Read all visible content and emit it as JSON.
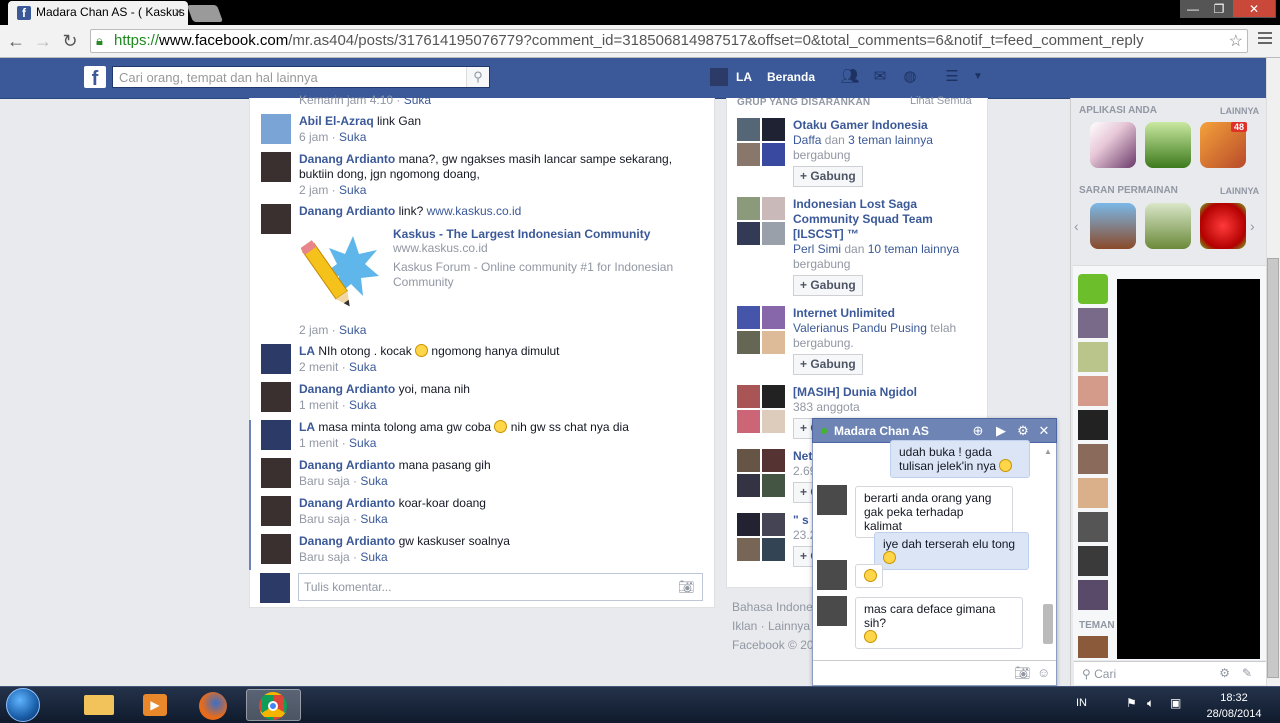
{
  "browser": {
    "tab_title": "Madara Chan AS - ( Kaskus",
    "tab_close": "×",
    "url_scheme": "https://",
    "url_host": "www.facebook.com",
    "url_path": "/mr.as404/posts/317614195076779?comment_id=318506814987517&offset=0&total_comments=6&notif_t=feed_comment_reply",
    "window_buttons": [
      "—",
      "❐",
      "✕"
    ]
  },
  "fb_header": {
    "logo": "f",
    "search_placeholder": "Cari orang, tempat dan hal lainnya",
    "user_name": "LA",
    "home_label": "Beranda"
  },
  "comments": [
    {
      "name": "",
      "text": "",
      "time": "Kemarin jam 4:10",
      "like": "Suka"
    },
    {
      "name": "Abil El-Azraq",
      "text": "link Gan",
      "time": "6 jam",
      "like": "Suka"
    },
    {
      "name": "Danang Ardianto",
      "text": "mana?, gw ngakses masih lancar sampe sekarang, buktiin dong, jgn ngomong doang,",
      "time": "2 jam",
      "like": "Suka"
    },
    {
      "name": "Danang Ardianto",
      "text": "link?",
      "link": "www.kaskus.co.id",
      "time": "2 jam",
      "like": "Suka"
    },
    {
      "name": "LA",
      "text": "NIh otong . kocak",
      "text2": "ngomong hanya dimulut",
      "time": "2 menit",
      "like": "Suka"
    },
    {
      "name": "Danang Ardianto",
      "text": "yoi, mana nih",
      "time": "1 menit",
      "like": "Suka"
    },
    {
      "name": "LA",
      "text": "masa minta tolong ama gw coba",
      "text2": "nih gw ss chat nya dia",
      "time": "1 menit",
      "like": "Suka"
    },
    {
      "name": "Danang Ardianto",
      "text": "mana pasang gih",
      "time": "Baru saja",
      "like": "Suka"
    },
    {
      "name": "Danang Ardianto",
      "text": "koar-koar doang",
      "time": "Baru saja",
      "like": "Suka"
    },
    {
      "name": "Danang Ardianto",
      "text": "gw kaskuser soalnya",
      "time": "Baru saja",
      "like": "Suka"
    }
  ],
  "link_card": {
    "title": "Kaskus - The Largest Indonesian Community",
    "url": "www.kaskus.co.id",
    "description": "Kaskus Forum - Online community #1 for Indonesian Community"
  },
  "comment_input_placeholder": "Tulis komentar...",
  "groups": {
    "title": "GRUP YANG DISARANKAN",
    "see_all": "Lihat Semua",
    "join_label": "+ Gabung",
    "items": [
      {
        "name": "Otaku Gamer Indonesia",
        "desc1": "Daffa",
        "desc_mid": " dan ",
        "desc_link": "3 teman lainnya",
        "desc2": " bergabung"
      },
      {
        "name": "Indonesian Lost Saga Community Squad Team [ILSCST] ™",
        "desc1": "Perl Simi",
        "desc_mid": " dan ",
        "desc_link": "10 teman lainnya",
        "desc2": " bergabung"
      },
      {
        "name": "Internet Unlimited",
        "desc1": "Valerianus Pandu Pusing",
        "desc_mid": " telah bergabung.",
        "desc_link": "",
        "desc2": ""
      },
      {
        "name": "[MASIH] Dunia Ngidol",
        "desc1": "383 anggota",
        "desc_mid": "",
        "desc_link": "",
        "desc2": ""
      },
      {
        "name": "Nett",
        "desc1": "2.69",
        "desc_mid": "",
        "desc_link": "",
        "desc2": ""
      },
      {
        "name": "\" s",
        "desc1": "23.2",
        "desc_mid": "",
        "desc_link": "",
        "desc2": ""
      }
    ]
  },
  "footer": {
    "line1": "Bahasa Indone",
    "line2": "Iklan · Lainnya ·",
    "line3": "Facebook © 20"
  },
  "chat": {
    "name": "Madara Chan AS",
    "messages": [
      {
        "from": "me",
        "text": "udah buka ! gada tulisan jelek'in nya"
      },
      {
        "from": "them",
        "text": "berarti anda orang yang gak peka terhadap kalimat"
      },
      {
        "from": "me",
        "text": "iye dah terserah elu tong"
      },
      {
        "from": "them",
        "text": ""
      },
      {
        "from": "them",
        "text": "mas cara deface gimana sih?"
      }
    ]
  },
  "right_sidebar": {
    "apps_title": "APLIKASI ANDA",
    "apps_more": "LAINNYA",
    "app_badge": "48",
    "games_title": "SARAN PERMAINAN",
    "games_more": "LAINNYA",
    "friends_title": "TEMAN",
    "search_placeholder": "Cari"
  },
  "taskbar": {
    "lang": "IN",
    "time": "18:32",
    "date": "28/08/2014"
  },
  "colors": {
    "fb_blue": "#3b5998",
    "link_blue": "#3b5998",
    "meta_gray": "#9197a3"
  }
}
